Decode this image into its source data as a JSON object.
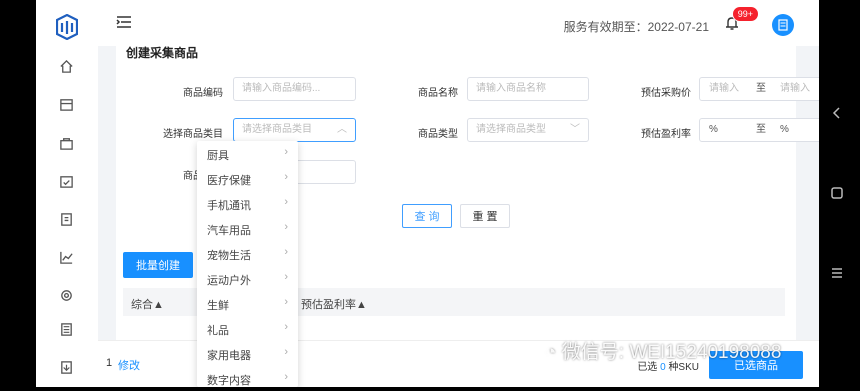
{
  "header": {
    "service_text": "服务有效期至：2022-07-21",
    "badge": "99+"
  },
  "card": {
    "title": "创建采集商品"
  },
  "form": {
    "code_label": "商品编码",
    "code_placeholder": "请输入商品编码...",
    "name_label": "商品名称",
    "name_placeholder": "请输入商品名称",
    "price_label": "预估采购价",
    "price_from_placeholder": "请输入",
    "to_text": "至",
    "price_to_placeholder": "请输入",
    "category_label": "选择商品类目",
    "category_placeholder": "请选择商品类目",
    "type_label": "商品类型",
    "type_placeholder": "请选择商品类型",
    "profit_label": "预估盈利率",
    "profit_from": "%",
    "profit_to": "%",
    "tag_label": "商品标签"
  },
  "buttons": {
    "query": "查 询",
    "reset": "重 置",
    "batch_create": "批量创建"
  },
  "table": {
    "headers": [
      "综合▲",
      "预估盈利率▲"
    ]
  },
  "dropdown": {
    "items": [
      "厨具",
      "医疗保健",
      "手机通讯",
      "汽车用品",
      "宠物生活",
      "运动户外",
      "生鲜",
      "礼品",
      "家用电器",
      "数字内容"
    ]
  },
  "footer": {
    "page": "1",
    "edit": "修改",
    "selected_prefix": "已选",
    "selected_count": "0",
    "selected_suffix": "种SKU",
    "selected_button": "已选商品"
  },
  "watermark": "微信号: WEI15240198088",
  "colors": {
    "primary": "#1890ff",
    "badge": "#f5222d"
  }
}
